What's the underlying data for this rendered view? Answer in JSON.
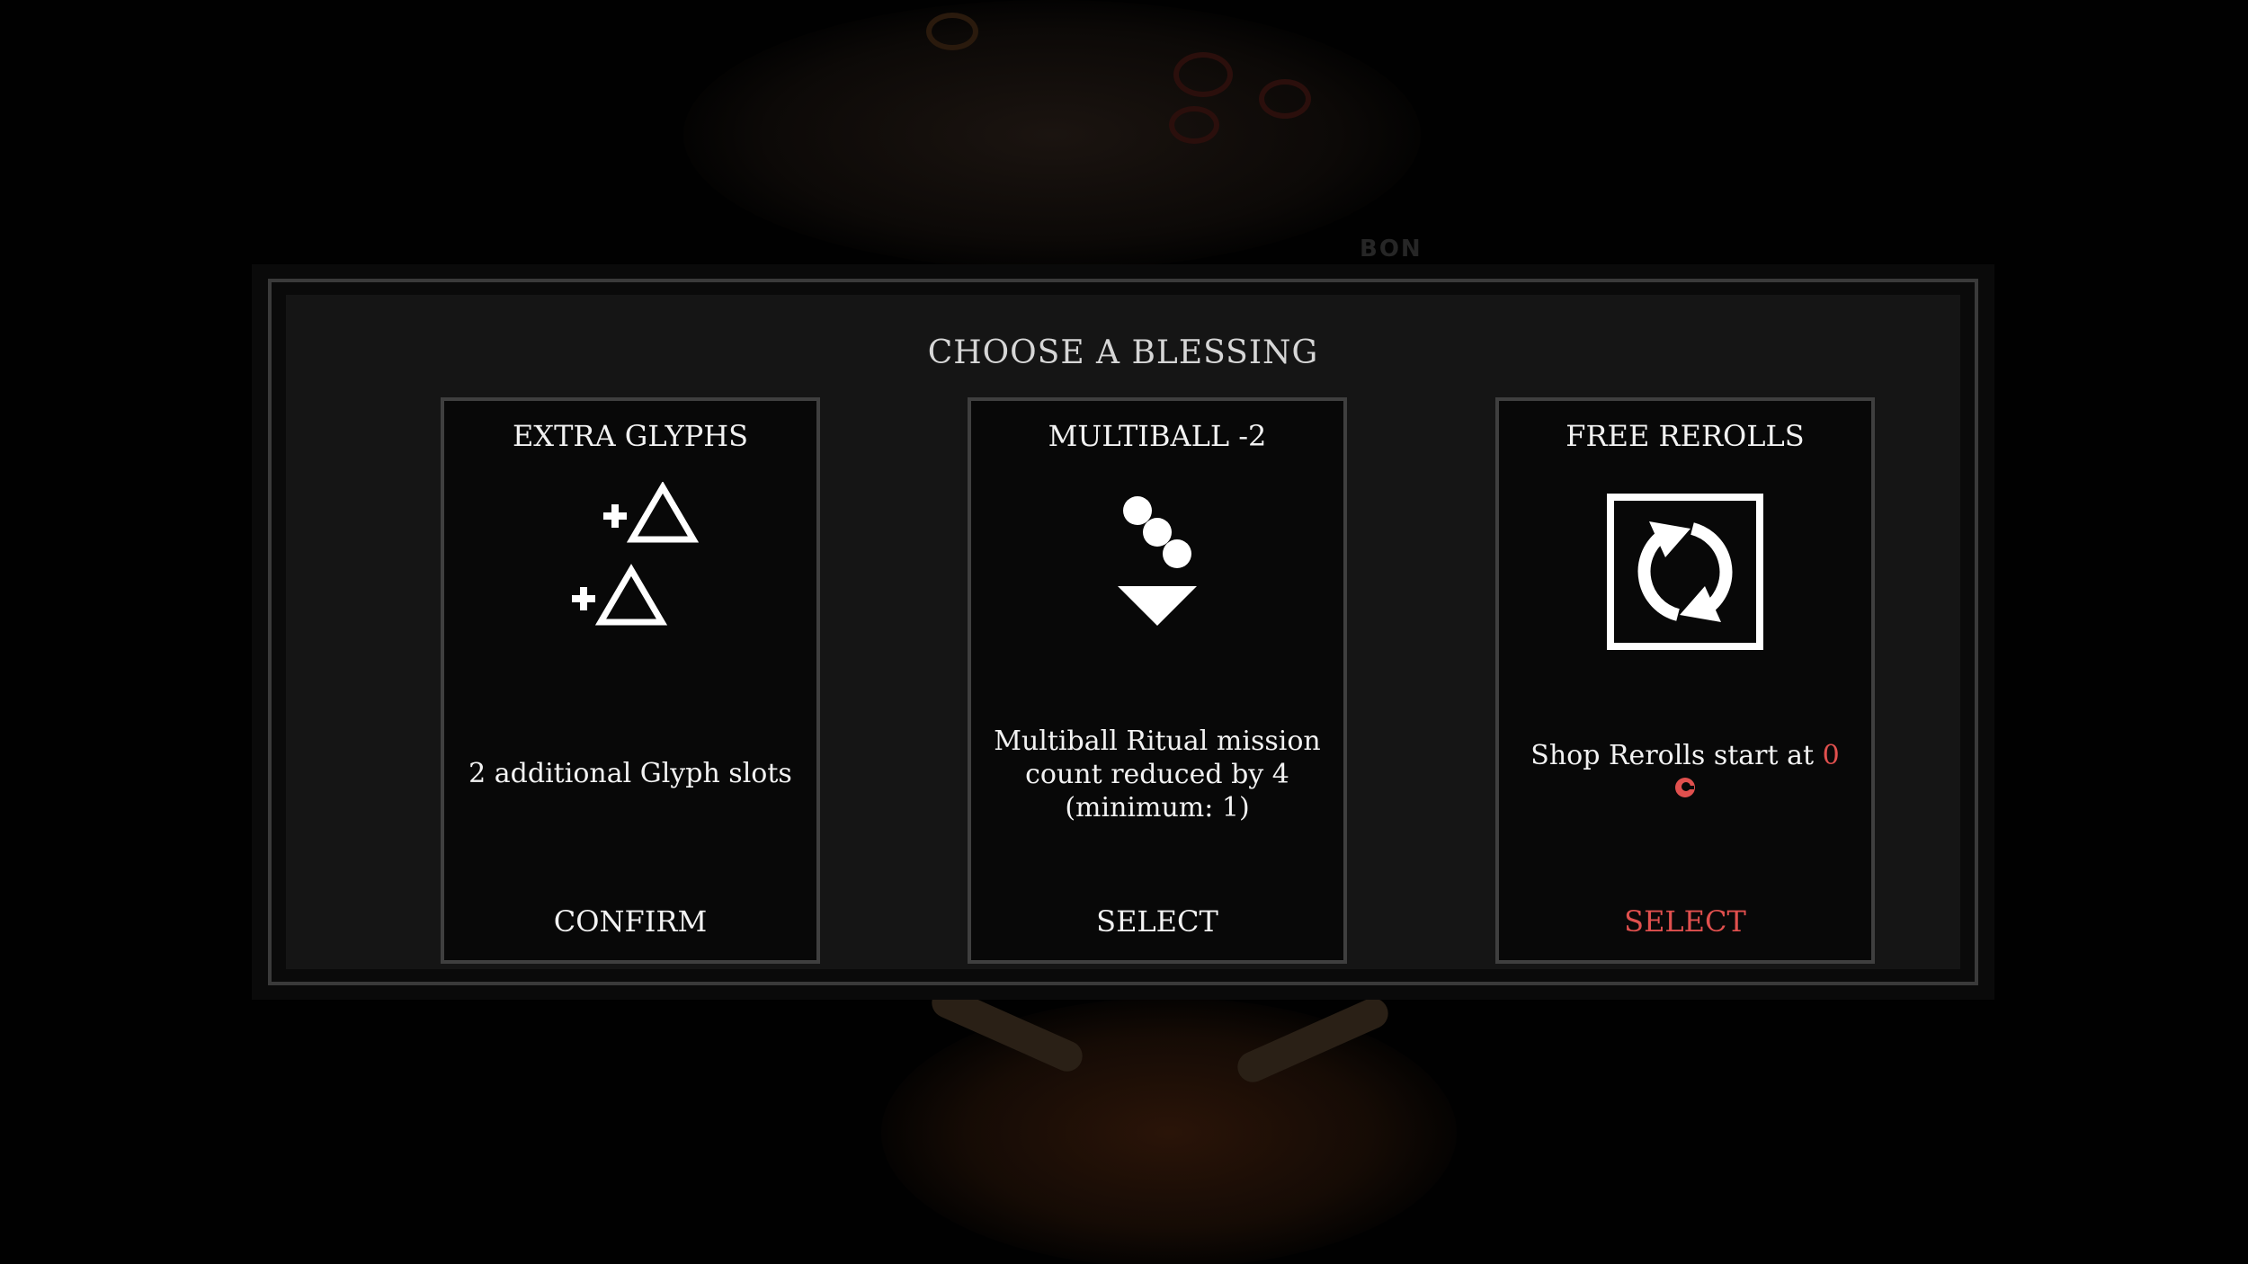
{
  "modal": {
    "title": "CHOOSE A BLESSING"
  },
  "background": {
    "partial_label": "BON"
  },
  "cards": [
    {
      "title": "EXTRA GLYPHS",
      "icon": "plus-triangles-icon",
      "description": "2 additional Glyph slots",
      "action": "CONFIRM"
    },
    {
      "title": "MULTIBALL -2",
      "icon": "falling-balls-icon",
      "description": "Multiball Ritual mission count reduced by 4 (minimum: 1)",
      "action": "SELECT"
    },
    {
      "title": "FREE REROLLS",
      "icon": "reroll-arrows-icon",
      "description_prefix": "Shop Rerolls start at",
      "description_value": "0",
      "currency_icon": "coin-icon",
      "action": "SELECT"
    }
  ],
  "colors": {
    "text": "#f2f2f2",
    "accent_red": "#e0504e",
    "card_border": "#3f3f3f",
    "modal_bg": "#151515"
  }
}
